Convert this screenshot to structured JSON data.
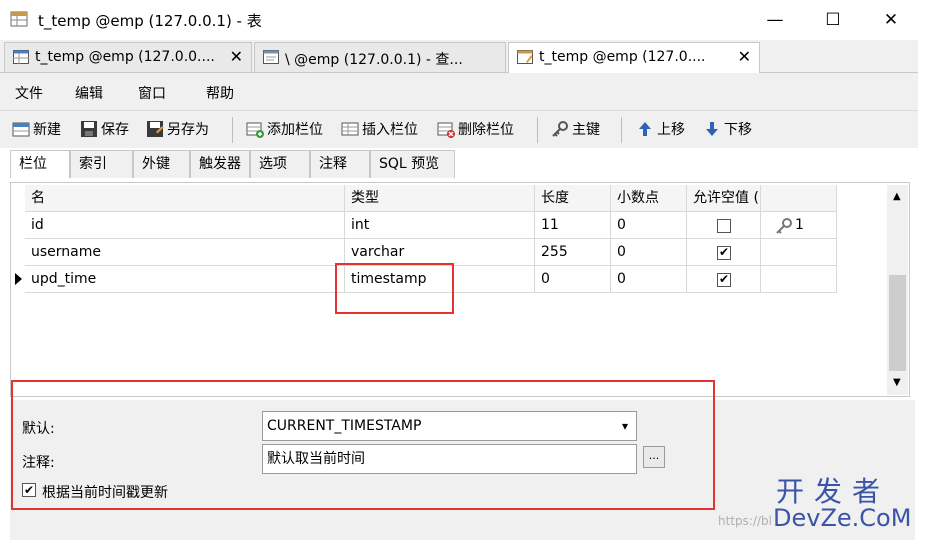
{
  "window": {
    "title": "t_temp @emp (127.0.0.1) - 表",
    "minimize": "—",
    "maximize": "☐",
    "close": "✕"
  },
  "doc_tabs": [
    {
      "label": "t_temp @emp (127.0.0....",
      "close": "✕"
    },
    {
      "label": "\\ @emp (127.0.0.1) - 查...",
      "close": ""
    },
    {
      "label": "t_temp @emp (127.0....",
      "close": "✕"
    }
  ],
  "menu": [
    "文件",
    "编辑",
    "窗口",
    "帮助"
  ],
  "toolbar": {
    "new": "新建",
    "save": "保存",
    "save_as": "另存为",
    "add_field": "添加栏位",
    "insert_field": "插入栏位",
    "delete_field": "删除栏位",
    "primary_key": "主键",
    "move_up": "上移",
    "move_down": "下移"
  },
  "prop_tabs": [
    "栏位",
    "索引",
    "外键",
    "触发器",
    "选项",
    "注释",
    "SQL 预览"
  ],
  "grid": {
    "headers": [
      "名",
      "类型",
      "长度",
      "小数点",
      "允许空值 ("
    ],
    "rows": [
      {
        "name": "id",
        "type": "int",
        "length": "11",
        "decimals": "0",
        "nullable": false,
        "key": "1"
      },
      {
        "name": "username",
        "type": "varchar",
        "length": "255",
        "decimals": "0",
        "nullable": true,
        "key": ""
      },
      {
        "name": "upd_time",
        "type": "timestamp",
        "length": "0",
        "decimals": "0",
        "nullable": true,
        "key": ""
      }
    ]
  },
  "form": {
    "default_label": "默认:",
    "default_value": "CURRENT_TIMESTAMP",
    "comment_label": "注释:",
    "comment_value": "默认取当前时间",
    "ellipsis": "...",
    "on_update_label": "根据当前时间戳更新",
    "on_update_checked": true
  },
  "watermark": {
    "cn": "开发者",
    "en": "DevZe.CoM",
    "url_frag": "https://bl"
  }
}
